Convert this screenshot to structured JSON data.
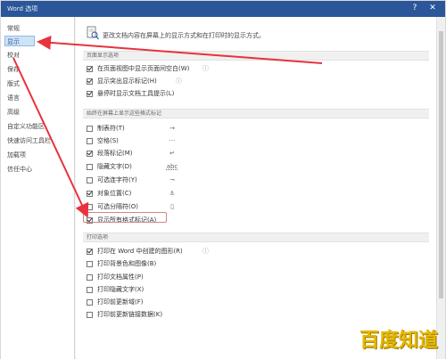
{
  "window": {
    "title": "Word 选项",
    "help": "?",
    "close": "✕"
  },
  "sidebar": {
    "items": [
      "常规",
      "显示",
      "校对",
      "保存",
      "版式",
      "语言",
      "高级",
      "自定义功能区",
      "快速访问工具栏",
      "加载项",
      "信任中心"
    ],
    "active_index": 1
  },
  "main": {
    "headline": "更改文档内容在屏幕上的显示方式和在打印时的显示方式。",
    "sections": [
      {
        "title": "页面显示选项",
        "options": [
          {
            "label": "在页面视图中显示页面间空白(W)",
            "checked": true,
            "info": "ⓘ"
          },
          {
            "label": "显示突出显示标记(H)",
            "checked": true,
            "info": "ⓘ"
          },
          {
            "label": "悬停时显示文档工具提示(L)",
            "checked": true,
            "info": ""
          }
        ]
      },
      {
        "title": "始终在屏幕上显示这些格式标记",
        "options": [
          {
            "label": "制表符(T)",
            "checked": false,
            "symbol": "→"
          },
          {
            "label": "空格(S)",
            "checked": false,
            "symbol": "···"
          },
          {
            "label": "段落标记(M)",
            "checked": true,
            "symbol": "↵"
          },
          {
            "label": "隐藏文字(D)",
            "checked": false,
            "symbol": "abc"
          },
          {
            "label": "可选连字符(Y)",
            "checked": false,
            "symbol": "¬"
          },
          {
            "label": "对象位置(C)",
            "checked": true,
            "symbol": "⚓"
          },
          {
            "label": "可选分隔符(O)",
            "checked": false,
            "symbol": "▯"
          },
          {
            "label": "显示所有格式标记(A)",
            "checked": true,
            "symbol": ""
          }
        ]
      },
      {
        "title": "打印选项",
        "options": [
          {
            "label": "打印在 Word 中创建的图形(R)",
            "checked": true,
            "info": "ⓘ"
          },
          {
            "label": "打印背景色和图像(B)",
            "checked": false,
            "info": ""
          },
          {
            "label": "打印文档属性(P)",
            "checked": false,
            "info": ""
          },
          {
            "label": "打印隐藏文字(X)",
            "checked": false,
            "info": ""
          },
          {
            "label": "打印前更新域(F)",
            "checked": false,
            "info": ""
          },
          {
            "label": "打印前更新链接数据(K)",
            "checked": false,
            "info": ""
          }
        ]
      }
    ]
  },
  "watermark": "百度知道",
  "colors": {
    "titlebar": "#2b579a",
    "arrow": "#e8323c",
    "active": "#cfe3f7"
  },
  "icons": {
    "doc": "document-magnifier-icon",
    "checkbox": "checkbox-icon"
  }
}
